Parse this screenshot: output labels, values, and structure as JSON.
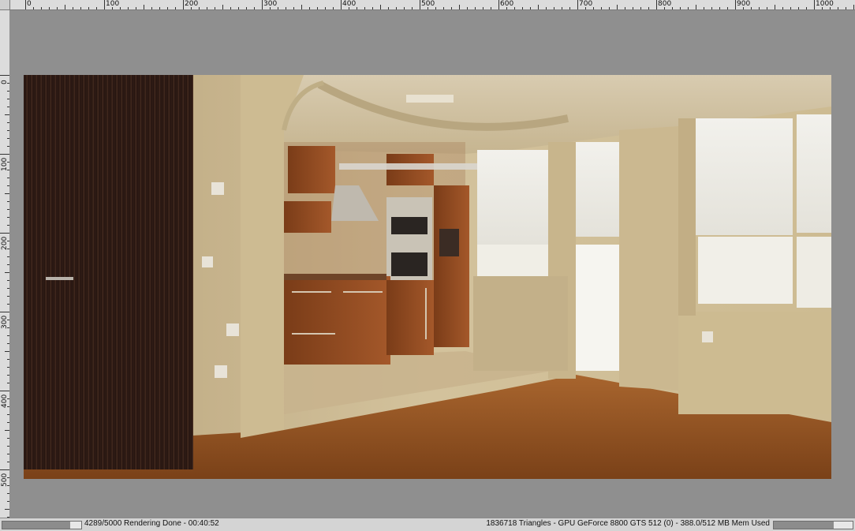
{
  "ruler": {
    "top_labels": [
      "0",
      "100",
      "200",
      "300",
      "400",
      "500",
      "600",
      "700",
      "800",
      "900",
      "1000"
    ],
    "left_labels": [
      "0",
      "100",
      "200",
      "300",
      "400",
      "500"
    ]
  },
  "status": {
    "progress_fraction": 0.8578,
    "render_status": "4289/5000 Rendering Done - 00:40:52",
    "gpu_info": "1836718 Triangles - GPU  GeForce 8800 GTS 512 (0) - 388.0/512 MB Mem Used",
    "memory_fraction": 0.7578
  },
  "colors": {
    "ui_background": "#8f8f8f",
    "ruler_background": "#dcdcdc",
    "wall": "#c9b58e",
    "floor": "#8a4f22",
    "door": "#2e1a12",
    "cabinet": "#8c4a22"
  }
}
